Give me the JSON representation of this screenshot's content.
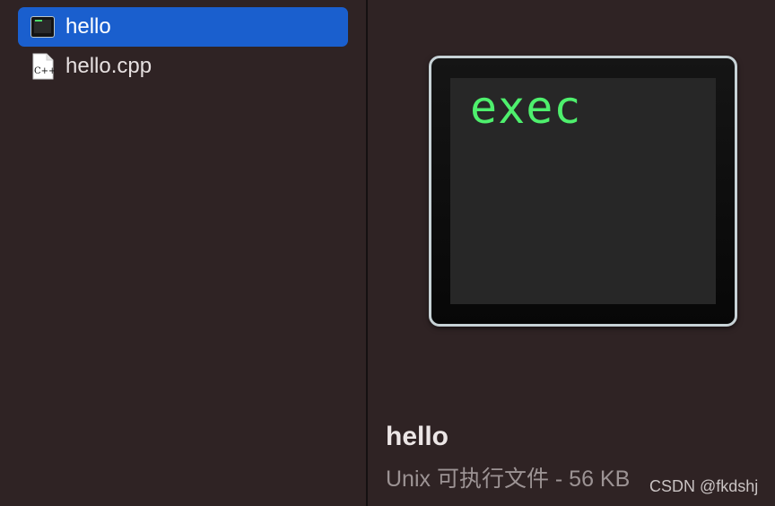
{
  "sidebar": {
    "files": [
      {
        "name": "hello",
        "icon": "executable-icon",
        "selected": true
      },
      {
        "name": "hello.cpp",
        "icon": "cpp-source-icon",
        "selected": false
      }
    ],
    "cpp_icon_glyph": "C++"
  },
  "preview": {
    "icon_text": "exec",
    "title": "hello",
    "subtitle": "Unix 可执行文件 - 56 KB"
  },
  "watermark": "CSDN @fkdshj",
  "colors": {
    "background": "#2f2324",
    "selection": "#1a5fce",
    "exec_green": "#4ef06d"
  }
}
